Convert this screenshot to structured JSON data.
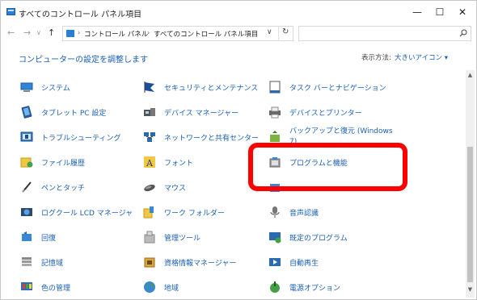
{
  "window": {
    "title": "すべてのコントロール パネル項目",
    "minimize": "—",
    "maximize": "☐",
    "close": "✕"
  },
  "address": {
    "back": "←",
    "forward": "→",
    "recent": "∨",
    "up": "↑",
    "crumbs": [
      "コントロール パネル",
      "すべてのコントロール パネル項目"
    ],
    "separator": "›",
    "dropdown": "∨",
    "refresh": "↻",
    "search_placeholder": ""
  },
  "header": {
    "title": "コンピューターの設定を調整します",
    "view_label": "表示方法:",
    "view_value": "大きいアイコン ▾"
  },
  "scrollbar": {
    "up": "▲",
    "down": "▼"
  },
  "items": {
    "system": "システム",
    "security": "セキュリティとメンテナンス",
    "taskbar": "タスク バーとナビゲーション",
    "tablet": "タブレット PC 設定",
    "device_manager": "デバイス マネージャー",
    "devices_printers": "デバイスとプリンター",
    "troubleshoot": "トラブルシューティング",
    "network": "ネットワークと共有センター",
    "backup": "バックアップと復元 (Windows 7)",
    "file_history": "ファイル履歴",
    "fonts": "フォント",
    "programs": "プログラムと機能",
    "pen_touch": "ペンとタッチ",
    "mouse": "マウス",
    "logitech_lcd": "ログクール LCD マネージャ",
    "work_folders": "ワーク フォルダー",
    "speech": "音声認識",
    "recovery": "回復",
    "admin_tools": "管理ツール",
    "default_programs": "既定のプログラム",
    "storage": "記憶域",
    "credential": "資格情報マネージャー",
    "autoplay": "自動再生",
    "color": "色の管理",
    "region": "地域",
    "power": "電源オプション"
  },
  "colors": {
    "link": "#1a5fb4",
    "highlight": "#ff0000"
  }
}
